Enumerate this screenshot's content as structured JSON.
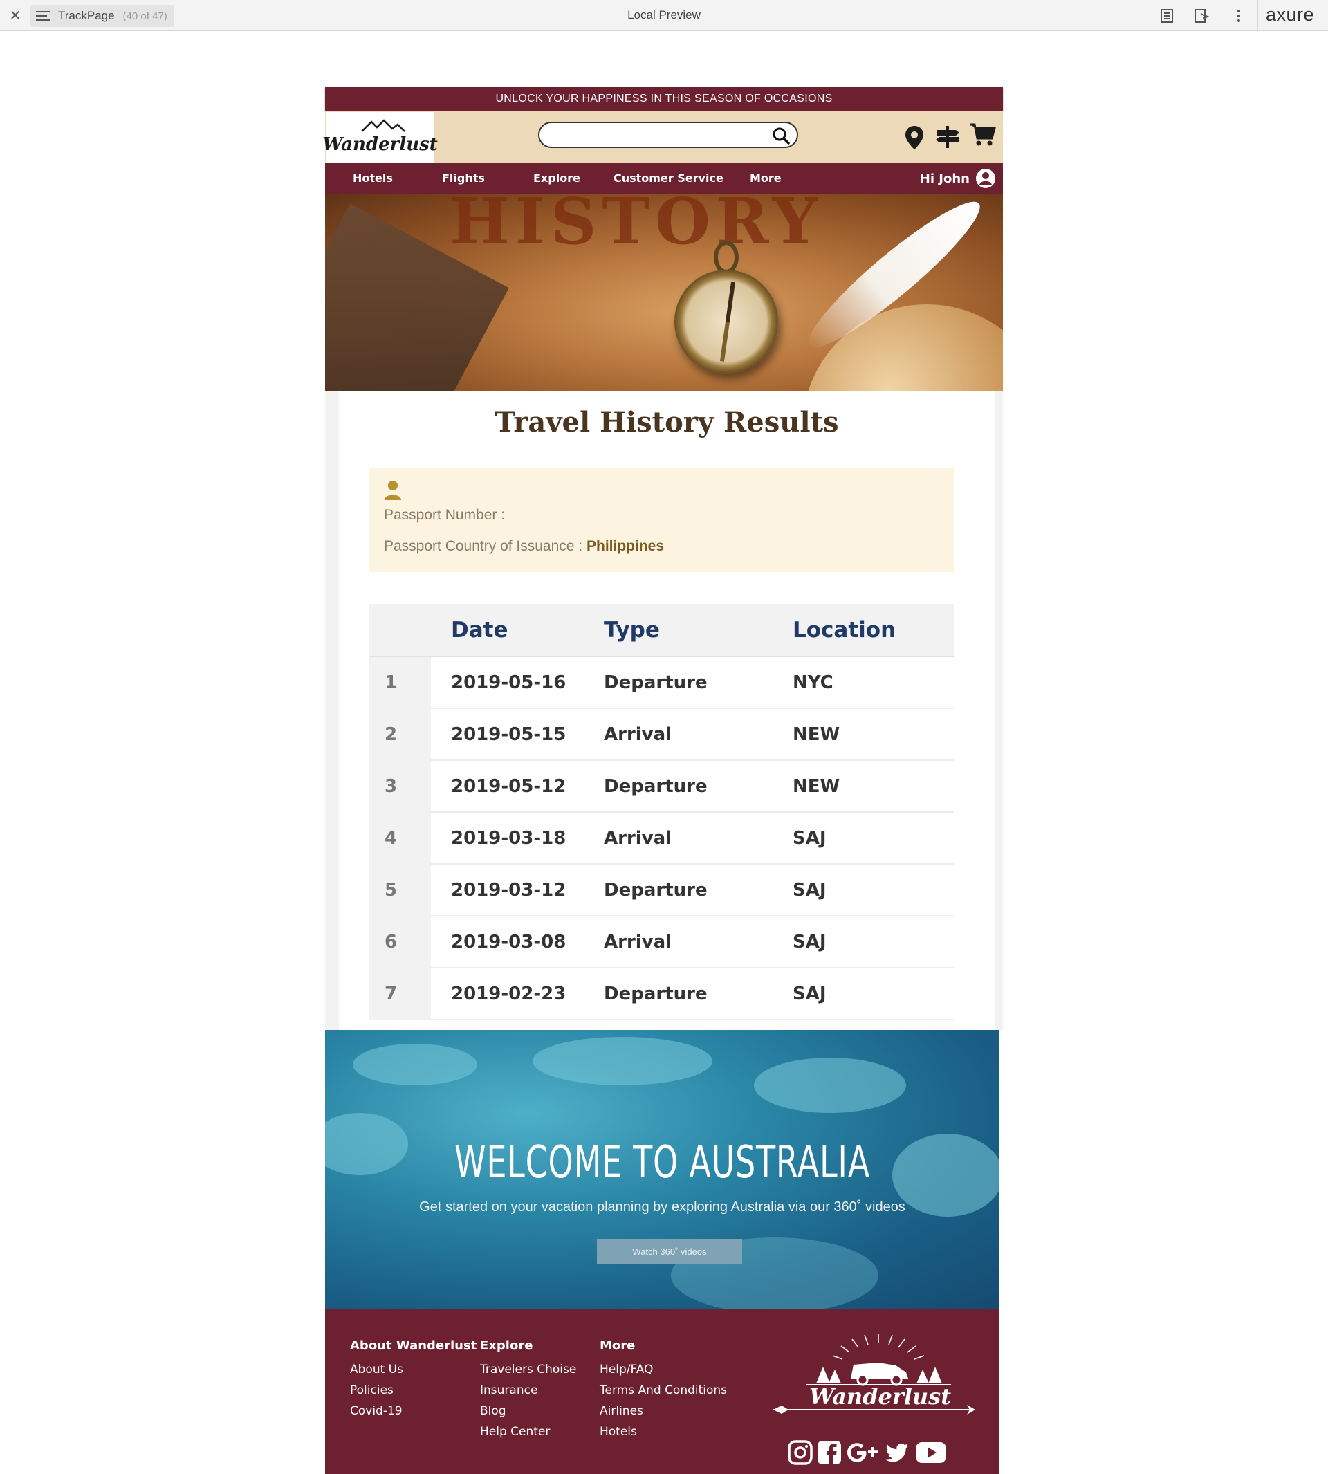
{
  "viewer": {
    "page_name": "TrackPage",
    "page_count": "(40 of 47)",
    "title": "Local Preview",
    "brand": "axure"
  },
  "promo_bar": {
    "text": "UNLOCK YOUR HAPPINESS IN THIS SEASON OF OCCASIONS"
  },
  "header": {
    "logo": "Wanderlust",
    "search_placeholder": "",
    "icons": [
      "location-pin-icon",
      "signpost-icon",
      "cart-icon"
    ]
  },
  "nav": {
    "items": [
      "Hotels",
      "Flights",
      "Explore",
      "Customer Service",
      "More"
    ],
    "user_greeting": "Hi John"
  },
  "hero": {
    "word": "HISTORY"
  },
  "results": {
    "title": "Travel History Results",
    "passport_number_label": "Passport Number :",
    "passport_number_value": "",
    "passport_country_label": "Passport Country of Issuance :",
    "passport_country_value": "Philippines",
    "columns": [
      "Date",
      "Type",
      "Location"
    ],
    "rows": [
      {
        "n": "1",
        "date": "2019-05-16",
        "type": "Departure",
        "location": "NYC"
      },
      {
        "n": "2",
        "date": "2019-05-15",
        "type": "Arrival",
        "location": "NEW"
      },
      {
        "n": "3",
        "date": "2019-05-12",
        "type": "Departure",
        "location": "NEW"
      },
      {
        "n": "4",
        "date": "2019-03-18",
        "type": "Arrival",
        "location": "SAJ"
      },
      {
        "n": "5",
        "date": "2019-03-12",
        "type": "Departure",
        "location": "SAJ"
      },
      {
        "n": "6",
        "date": "2019-03-08",
        "type": "Arrival",
        "location": "SAJ"
      },
      {
        "n": "7",
        "date": "2019-02-23",
        "type": "Departure",
        "location": "SAJ"
      }
    ]
  },
  "promo_aus": {
    "title": "WELCOME TO AUSTRALIA",
    "subtitle": "Get started on your vacation planning by exploring Australia via our 360˚ videos",
    "button": "Watch 360˚ videos"
  },
  "footer": {
    "about": {
      "heading": "About Wanderlust",
      "links": [
        "About Us",
        "Policies",
        "Covid-19"
      ]
    },
    "explore": {
      "heading": "Explore",
      "links": [
        "Travelers Choise",
        "Insurance",
        "Blog",
        "Help Center"
      ]
    },
    "more": {
      "heading": "More",
      "links": [
        "Help/FAQ",
        "Terms And Conditions",
        "Airlines",
        "Hotels"
      ]
    },
    "brand": "Wanderlust",
    "social": [
      "instagram-icon",
      "facebook-icon",
      "google-plus-icon",
      "twitter-icon",
      "youtube-icon"
    ]
  },
  "colors": {
    "brand_maroon": "#6d2130",
    "header_tan": "#ecd9b7",
    "passport_bg": "#fcf3e1",
    "table_header_text": "#1f3a66"
  }
}
